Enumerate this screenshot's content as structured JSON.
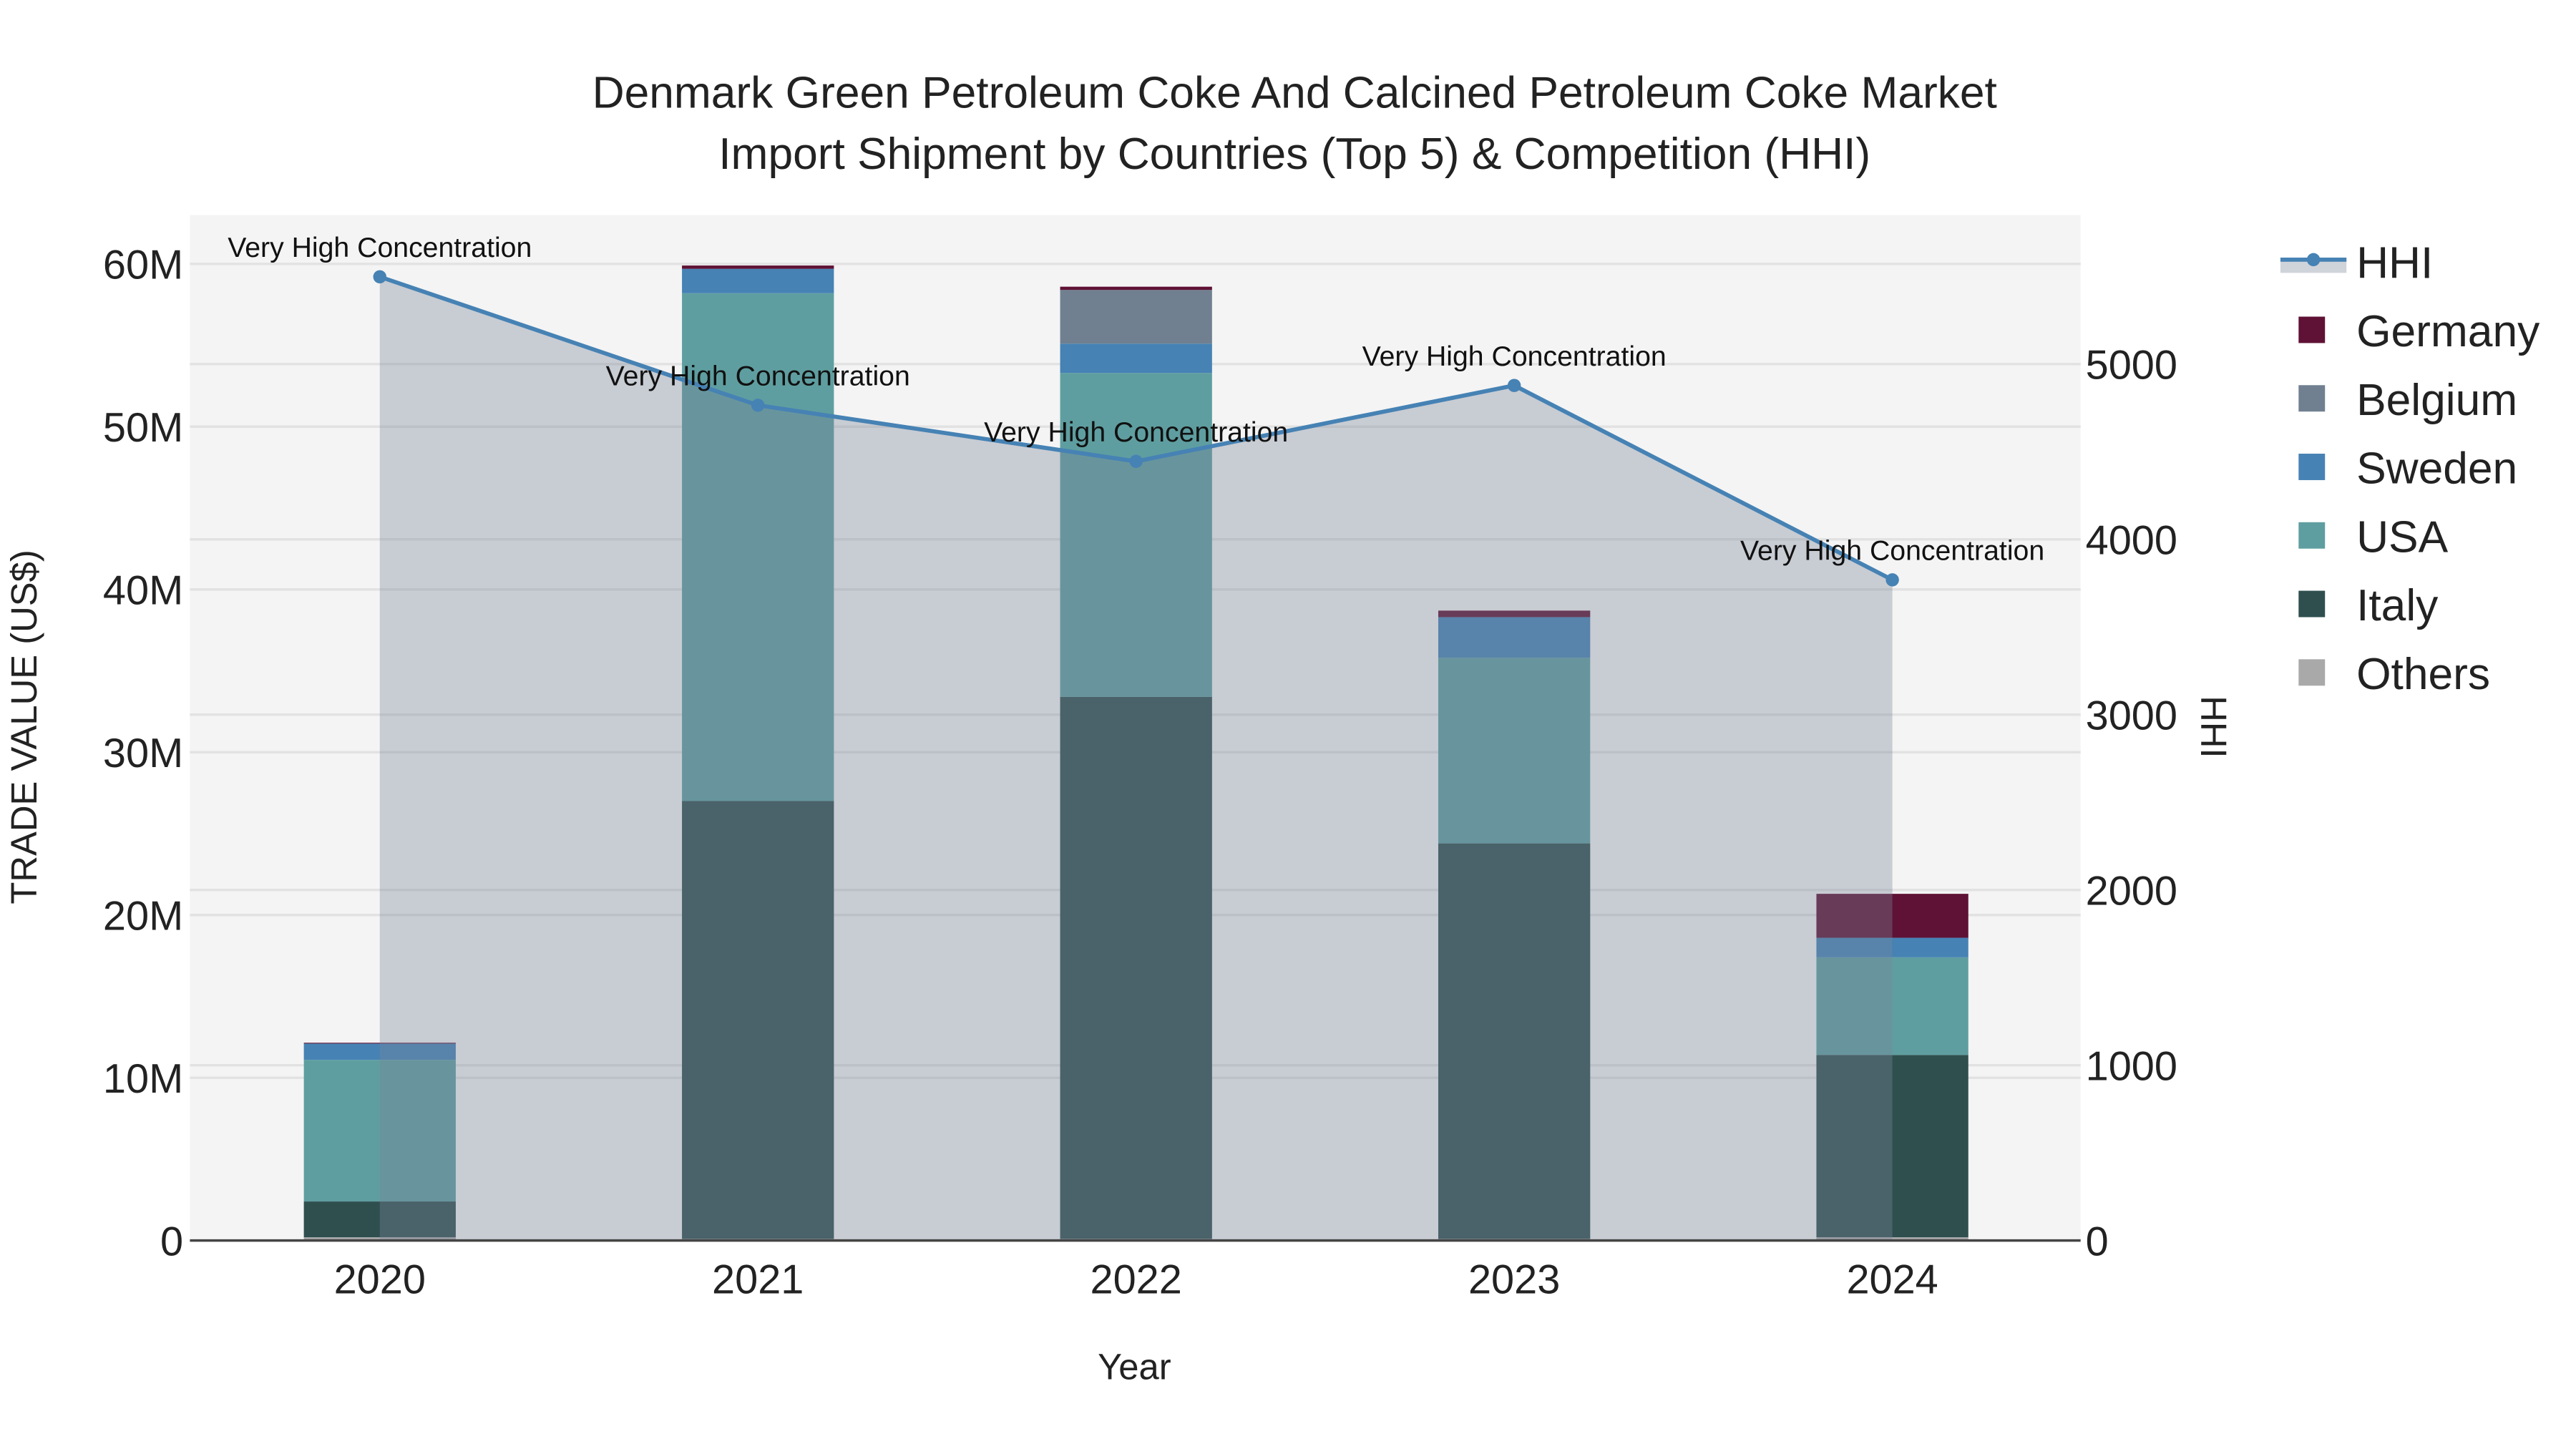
{
  "chart_data": {
    "type": "bar",
    "title_lines": [
      "Denmark Green Petroleum Coke And Calcined Petroleum Coke Market",
      "Import Shipment by Countries (Top 5) & Competition (HHI)"
    ],
    "xlabel": "Year",
    "ylabel": "TRADE VALUE (US$)",
    "y2label": "HHI",
    "categories": [
      "2020",
      "2021",
      "2022",
      "2023",
      "2024"
    ],
    "stacked": true,
    "ylim": [
      0,
      63000000
    ],
    "y2lim": [
      0,
      5850
    ],
    "yticks": [
      {
        "v": 0,
        "label": "0"
      },
      {
        "v": 10000000,
        "label": "10M"
      },
      {
        "v": 20000000,
        "label": "20M"
      },
      {
        "v": 30000000,
        "label": "30M"
      },
      {
        "v": 40000000,
        "label": "40M"
      },
      {
        "v": 50000000,
        "label": "50M"
      },
      {
        "v": 60000000,
        "label": "60M"
      }
    ],
    "y2ticks": [
      {
        "v": 0,
        "label": "0"
      },
      {
        "v": 1000,
        "label": "1000"
      },
      {
        "v": 2000,
        "label": "2000"
      },
      {
        "v": 3000,
        "label": "3000"
      },
      {
        "v": 4000,
        "label": "4000"
      },
      {
        "v": 5000,
        "label": "5000"
      }
    ],
    "grid": true,
    "legend_placement": "right",
    "series": [
      {
        "name": "Others",
        "color": "#a9a9a9",
        "values": [
          200000,
          100000,
          100000,
          100000,
          200000
        ]
      },
      {
        "name": "Italy",
        "color": "#2f4f4f",
        "values": [
          2200000,
          26900000,
          33300000,
          24300000,
          11200000
        ]
      },
      {
        "name": "USA",
        "color": "#5f9ea0",
        "values": [
          8700000,
          31200000,
          19900000,
          11400000,
          6000000
        ]
      },
      {
        "name": "Sweden",
        "color": "#4682b4",
        "values": [
          1000000,
          1500000,
          1800000,
          2500000,
          1200000
        ]
      },
      {
        "name": "Belgium",
        "color": "#708090",
        "values": [
          0,
          0,
          3300000,
          0,
          0
        ]
      },
      {
        "name": "Germany",
        "color": "#5f1235",
        "values": [
          50000,
          200000,
          200000,
          400000,
          2700000
        ]
      }
    ],
    "hhi": {
      "name": "HHI",
      "color": "#4682b4",
      "values": [
        5498,
        4765,
        4445,
        4878,
        3769
      ],
      "annotations": [
        "Very High Concentration",
        "Very High Concentration",
        "Very High Concentration",
        "Very High Concentration",
        "Very High Concentration"
      ]
    },
    "legend_order": [
      "HHI",
      "Germany",
      "Belgium",
      "Sweden",
      "USA",
      "Italy",
      "Others"
    ]
  }
}
